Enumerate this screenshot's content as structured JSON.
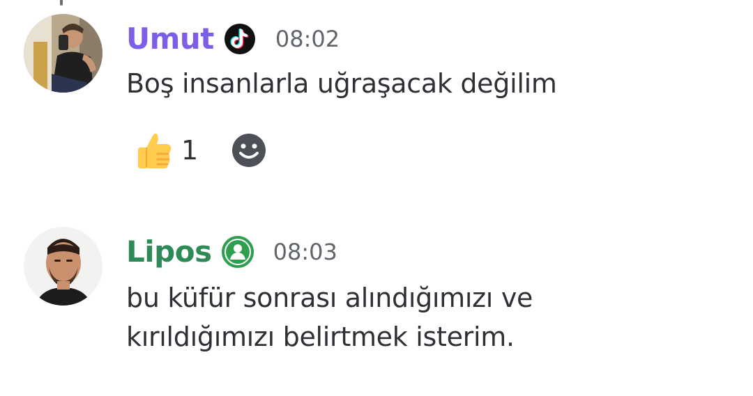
{
  "messages": [
    {
      "author": "Umut",
      "name_color": "#7c5fe6",
      "badge": "tiktok-icon",
      "timestamp": "08:02",
      "lines": [
        "Boş insanlarla uğraşacak değilim"
      ],
      "reactions": [
        {
          "emoji": "thumbs-up-icon",
          "count": "1"
        }
      ],
      "add_reaction_icon": "smiley-add-reaction-icon"
    },
    {
      "author": "Lipos",
      "name_color": "#2e8b57",
      "badge": "green-user-badge-icon",
      "timestamp": "08:03",
      "lines": [
        "bu küfür sonrası alındığımızı ve",
        "kırıldığımızı belirtmek isterim."
      ]
    }
  ]
}
